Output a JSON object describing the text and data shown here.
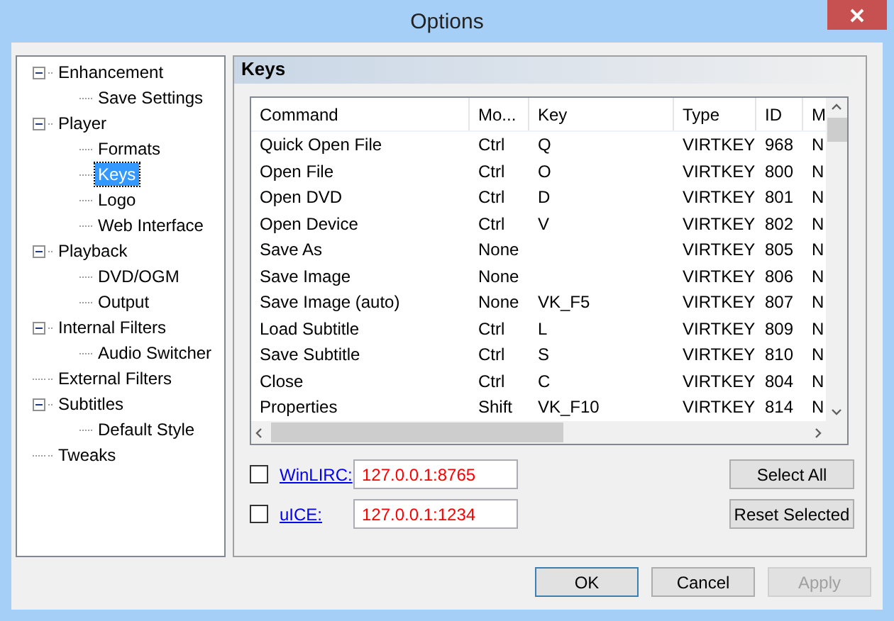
{
  "window": {
    "title": "Options"
  },
  "tree": [
    {
      "label": "Enhancement",
      "expanded": true,
      "selected": false,
      "children": [
        {
          "label": "Save Settings",
          "selected": false
        }
      ]
    },
    {
      "label": "Player",
      "expanded": true,
      "selected": false,
      "children": [
        {
          "label": "Formats",
          "selected": false
        },
        {
          "label": "Keys",
          "selected": true
        },
        {
          "label": "Logo",
          "selected": false
        },
        {
          "label": "Web Interface",
          "selected": false
        }
      ]
    },
    {
      "label": "Playback",
      "expanded": true,
      "selected": false,
      "children": [
        {
          "label": "DVD/OGM",
          "selected": false
        },
        {
          "label": "Output",
          "selected": false
        }
      ]
    },
    {
      "label": "Internal Filters",
      "expanded": true,
      "selected": false,
      "children": [
        {
          "label": "Audio Switcher",
          "selected": false
        }
      ]
    },
    {
      "label": "External Filters",
      "selected": false
    },
    {
      "label": "Subtitles",
      "expanded": true,
      "selected": false,
      "children": [
        {
          "label": "Default Style",
          "selected": false
        }
      ]
    },
    {
      "label": "Tweaks",
      "selected": false
    }
  ],
  "page_title": "Keys",
  "table": {
    "columns": [
      "Command",
      "Mo...",
      "Key",
      "Type",
      "ID",
      "M"
    ],
    "rows": [
      [
        "Quick Open File",
        "Ctrl",
        "Q",
        "VIRTKEY",
        "968",
        "N"
      ],
      [
        "Open File",
        "Ctrl",
        "O",
        "VIRTKEY",
        "800",
        "N"
      ],
      [
        "Open DVD",
        "Ctrl",
        "D",
        "VIRTKEY",
        "801",
        "N"
      ],
      [
        "Open Device",
        "Ctrl",
        "V",
        "VIRTKEY",
        "802",
        "N"
      ],
      [
        "Save As",
        "None",
        "",
        "VIRTKEY",
        "805",
        "N"
      ],
      [
        "Save Image",
        "None",
        "",
        "VIRTKEY",
        "806",
        "N"
      ],
      [
        "Save Image (auto)",
        "None",
        "VK_F5",
        "VIRTKEY",
        "807",
        "N"
      ],
      [
        "Load Subtitle",
        "Ctrl",
        "L",
        "VIRTKEY",
        "809",
        "N"
      ],
      [
        "Save Subtitle",
        "Ctrl",
        "S",
        "VIRTKEY",
        "810",
        "N"
      ],
      [
        "Close",
        "Ctrl",
        "C",
        "VIRTKEY",
        "804",
        "N"
      ],
      [
        "Properties",
        "Shift",
        "VK_F10",
        "VIRTKEY",
        "814",
        "N"
      ]
    ]
  },
  "remotes": [
    {
      "label": "WinLIRC:",
      "checked": false,
      "value": "127.0.0.1:8765"
    },
    {
      "label": "uICE:",
      "checked": false,
      "value": "127.0.0.1:1234"
    }
  ],
  "side_buttons": [
    "Select All",
    "Reset Selected"
  ],
  "buttons": [
    {
      "label": "OK",
      "default": true,
      "disabled": false
    },
    {
      "label": "Cancel",
      "default": false,
      "disabled": false
    },
    {
      "label": "Apply",
      "default": false,
      "disabled": true
    }
  ]
}
